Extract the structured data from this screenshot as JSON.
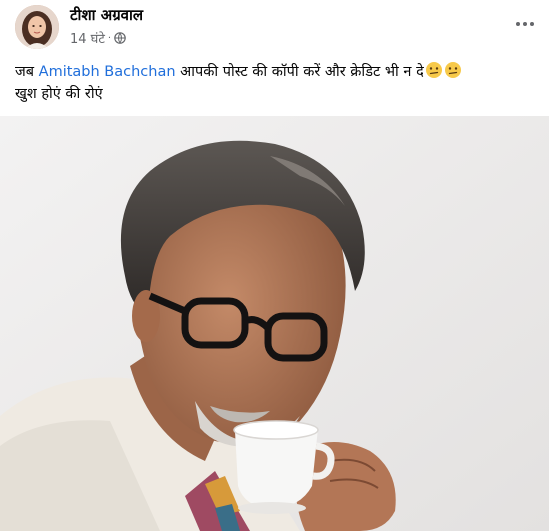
{
  "post": {
    "author": "टीशा अग्रवाल",
    "time": "14 घंटे",
    "privacy_icon": "globe-icon",
    "more_icon": "more-options-icon",
    "caption": {
      "before": "जब ",
      "mention": "Amitabh Bachchan",
      "after": "  आपकी पोस्ट की कॉपी करें और क्रेडिट भी न दे",
      "line2": "खुश होएं की रोएं",
      "emoji_icon": "confused-face-emoji-icon"
    },
    "photo": "portrait photo of man in glasses sipping from a cup"
  },
  "colors": {
    "link": "#216fdb",
    "muted": "#65676b",
    "text": "#050505"
  }
}
